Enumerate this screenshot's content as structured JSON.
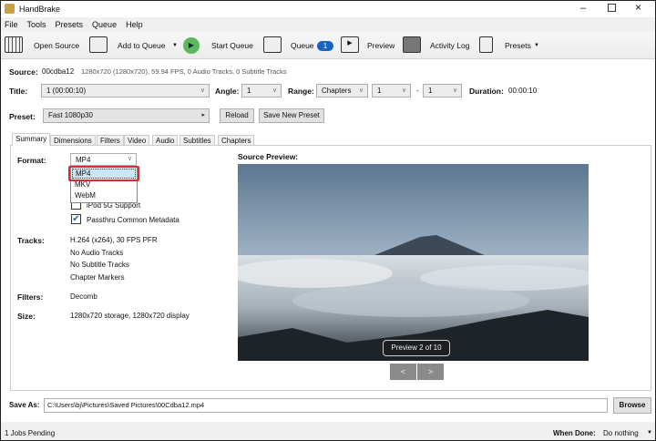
{
  "window": {
    "title": "HandBrake",
    "controls": [
      "minimize",
      "maximize",
      "close"
    ]
  },
  "menu": [
    "File",
    "Tools",
    "Presets",
    "Queue",
    "Help"
  ],
  "toolbar": {
    "open_source": "Open Source",
    "add_to_queue": "Add to Queue",
    "start_queue": "Start Queue",
    "queue": "Queue",
    "queue_count": "1",
    "preview": "Preview",
    "activity_log": "Activity Log",
    "presets": "Presets"
  },
  "source": {
    "label": "Source:",
    "name": "00cdba12",
    "info": "1280x720 (1280x720), 59.94 FPS, 0 Audio Tracks, 0 Subtitle Tracks"
  },
  "title_row": {
    "title_label": "Title:",
    "title_value": "1  (00:00:10)",
    "angle_label": "Angle:",
    "angle_value": "1",
    "range_label": "Range:",
    "range_value": "Chapters",
    "range_from": "1",
    "range_sep": "-",
    "range_to": "1",
    "duration_label": "Duration:",
    "duration_value": "00:00:10"
  },
  "preset": {
    "label": "Preset:",
    "value": "Fast 1080p30",
    "reload": "Reload",
    "save_new": "Save New Preset"
  },
  "tabs": [
    "Summary",
    "Dimensions",
    "Filters",
    "Video",
    "Audio",
    "Subtitles",
    "Chapters"
  ],
  "summary": {
    "format_label": "Format:",
    "format_value": "MP4",
    "format_options": [
      "MP4",
      "MKV",
      "WebM"
    ],
    "ipod": "iPod 5G Support",
    "ipod_checked": false,
    "passthru": "Passthru Common Metadata",
    "passthru_checked": true,
    "tracks_label": "Tracks:",
    "tracks": [
      "H.264 (x264), 30 FPS PFR",
      "No Audio Tracks",
      "No Subtitle Tracks",
      "Chapter Markers"
    ],
    "filters_label": "Filters:",
    "filters_value": "Decomb",
    "size_label": "Size:",
    "size_value": "1280x720 storage, 1280x720 display"
  },
  "preview": {
    "title": "Source Preview:",
    "caption": "Preview 2 of 10",
    "prev": "<",
    "next": ">"
  },
  "save": {
    "label": "Save As:",
    "path": "C:\\Users\\bj\\Pictures\\Saved Pictures\\00Cdba12.mp4",
    "browse": "Browse"
  },
  "status": {
    "jobs": "1 Jobs Pending",
    "when_done_label": "When Done:",
    "when_done_value": "Do nothing"
  },
  "colors": {
    "highlight": "#d32f2f",
    "badge": "#1565c0",
    "start": "#5cb85c"
  }
}
